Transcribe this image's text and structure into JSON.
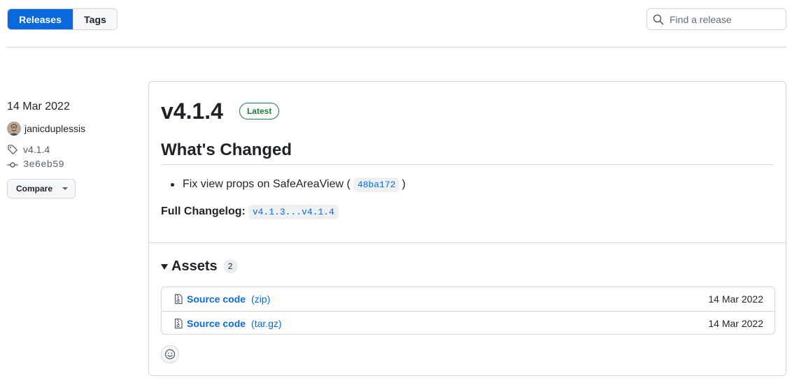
{
  "tabs": [
    {
      "label": "Releases",
      "active": true
    },
    {
      "label": "Tags",
      "active": false
    }
  ],
  "search": {
    "placeholder": "Find a release",
    "value": ""
  },
  "release": {
    "date": "14 Mar 2022",
    "author": "janicduplessis",
    "tag": "v4.1.4",
    "commit": "3e6eb59",
    "compare_label": "Compare",
    "title": "v4.1.4",
    "badge": "Latest",
    "heading": "What's Changed",
    "changes": [
      {
        "text": "Fix view props on SafeAreaView (",
        "commit": "48ba172",
        "suffix": ")"
      }
    ],
    "full_changelog_label": "Full Changelog",
    "full_changelog_colon": ":",
    "full_changelog_link": "v4.1.3...v4.1.4"
  },
  "assets": {
    "title": "Assets",
    "count": "2",
    "items": [
      {
        "name": "Source code",
        "ext": "(zip)",
        "date": "14 Mar 2022"
      },
      {
        "name": "Source code",
        "ext": "(tar.gz)",
        "date": "14 Mar 2022"
      }
    ]
  },
  "colors": {
    "accent": "#0969da",
    "latest_green": "#1a7f37",
    "border": "#d0d7de"
  },
  "icons": {
    "search": "search-icon",
    "tag": "tag-icon",
    "commit": "git-commit-icon",
    "file_zip": "file-zip-icon",
    "reaction": "smiley-icon"
  }
}
